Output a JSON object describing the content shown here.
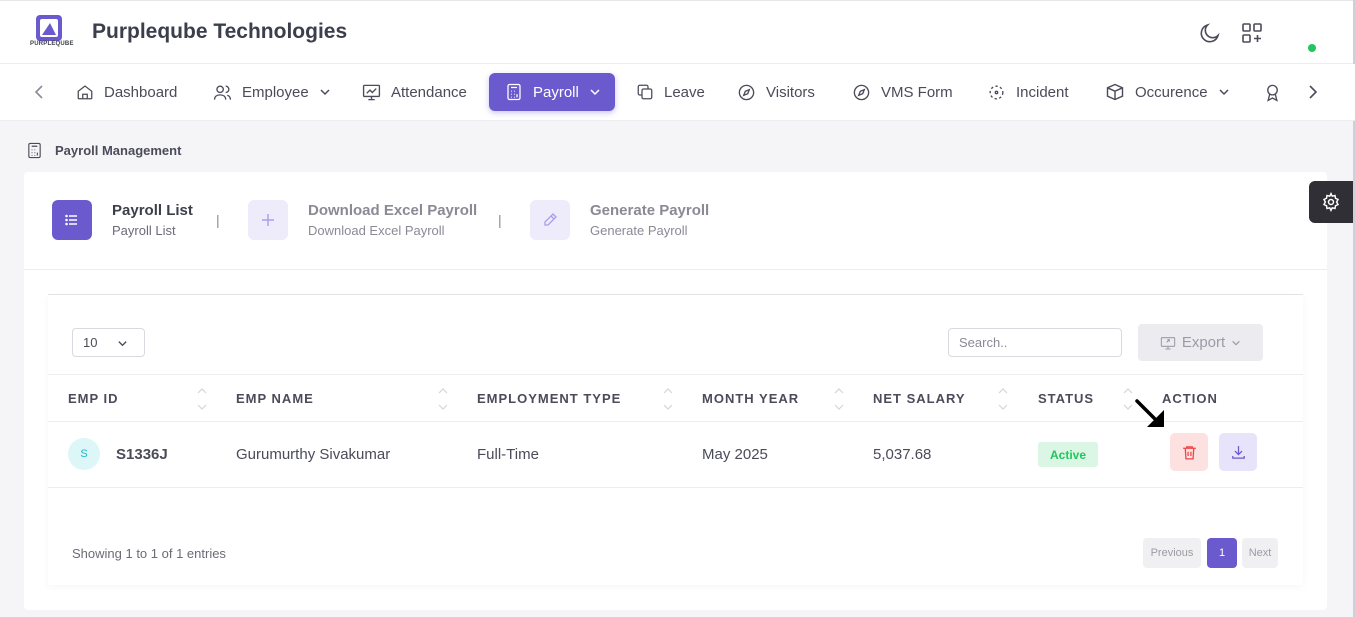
{
  "header": {
    "logo_text": "PURPLEQUBE",
    "brand": "Purpleqube Technologies",
    "theme_toggle_icon": "moon-icon",
    "apps_icon": "apps-grid-icon",
    "online_status_color": "#22c55e"
  },
  "nav": {
    "items": [
      {
        "label": "Dashboard",
        "icon": "home-icon"
      },
      {
        "label": "Employee",
        "icon": "users-icon",
        "dropdown": true
      },
      {
        "label": "Attendance",
        "icon": "presentation-icon"
      },
      {
        "label": "Payroll",
        "icon": "calculator-icon",
        "dropdown": true,
        "active": true
      },
      {
        "label": "Leave",
        "icon": "copy-icon"
      },
      {
        "label": "Visitors",
        "icon": "compass-icon"
      },
      {
        "label": "VMS Form",
        "icon": "compass-icon"
      },
      {
        "label": "Incident",
        "icon": "focus-icon"
      },
      {
        "label": "Occurence",
        "icon": "box-icon",
        "dropdown": true
      }
    ],
    "accent": "#6a5acd"
  },
  "breadcrumb": {
    "label": "Payroll Management"
  },
  "steps": [
    {
      "title": "Payroll List",
      "subtitle": "Payroll List",
      "active": true
    },
    {
      "title": "Download Excel Payroll",
      "subtitle": "Download Excel Payroll",
      "active": false
    },
    {
      "title": "Generate Payroll",
      "subtitle": "Generate Payroll",
      "active": false
    }
  ],
  "step_separator": "|",
  "table_controls": {
    "page_length": "10",
    "search_placeholder": "Search..",
    "export_label": "Export"
  },
  "table": {
    "columns": [
      "EMP ID",
      "EMP NAME",
      "EMPLOYMENT TYPE",
      "MONTH YEAR",
      "NET SALARY",
      "STATUS",
      "ACTION"
    ],
    "rows": [
      {
        "avatar": "S",
        "emp_id": "S1336J",
        "emp_name": "Gurumurthy Sivakumar",
        "employment_type": "Full-Time",
        "month_year": "May 2025",
        "net_salary": "5,037.68",
        "status": "Active",
        "actions": [
          "trash-icon",
          "download-icon"
        ]
      }
    ]
  },
  "footer": {
    "info": "Showing 1 to 1 of 1 entries",
    "previous": "Previous",
    "page": "1",
    "next": "Next"
  },
  "colors": {
    "status_active_bg": "#dcf6e6",
    "status_active_text": "#22c55e",
    "delete_bg": "#fde0e0",
    "delete_icon": "#ef4444",
    "download_bg": "#e6e3fb"
  }
}
